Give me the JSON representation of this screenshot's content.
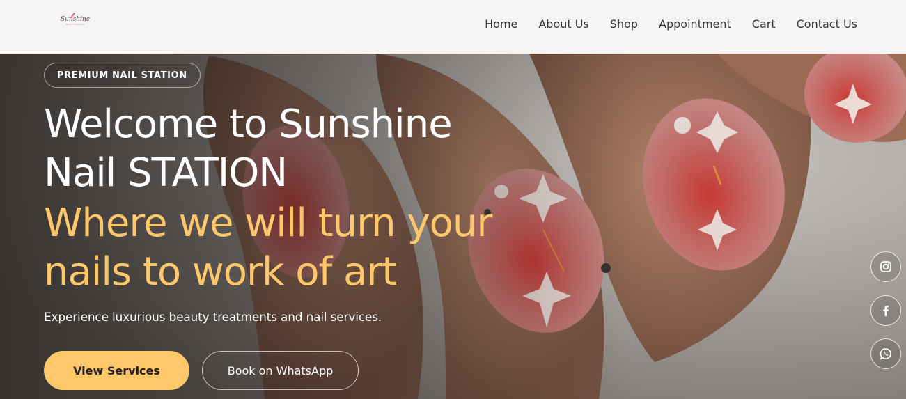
{
  "brand": {
    "logo_script": "Sunshine",
    "logo_sub": "NAIL STATION"
  },
  "nav": {
    "items": [
      {
        "label": "Home"
      },
      {
        "label": "About Us"
      },
      {
        "label": "Shop"
      },
      {
        "label": "Appointment"
      },
      {
        "label": "Cart"
      },
      {
        "label": "Contact Us"
      }
    ]
  },
  "hero": {
    "badge": "PREMIUM NAIL STATION",
    "title_line1": "Welcome to Sunshine",
    "title_line2": "Nail STATION",
    "subtitle_line1": "Where we will turn your",
    "subtitle_line2": "nails to work of art",
    "description": "Experience luxurious beauty treatments and nail services.",
    "primary_button": "View Services",
    "secondary_button": "Book on WhatsApp"
  },
  "social": [
    {
      "icon": "instagram-icon"
    },
    {
      "icon": "facebook-icon"
    },
    {
      "icon": "whatsapp-icon"
    }
  ],
  "colors": {
    "accent": "#fdc76a",
    "nav_bg": "#f6f5f4",
    "hero_text": "#ffffff"
  }
}
